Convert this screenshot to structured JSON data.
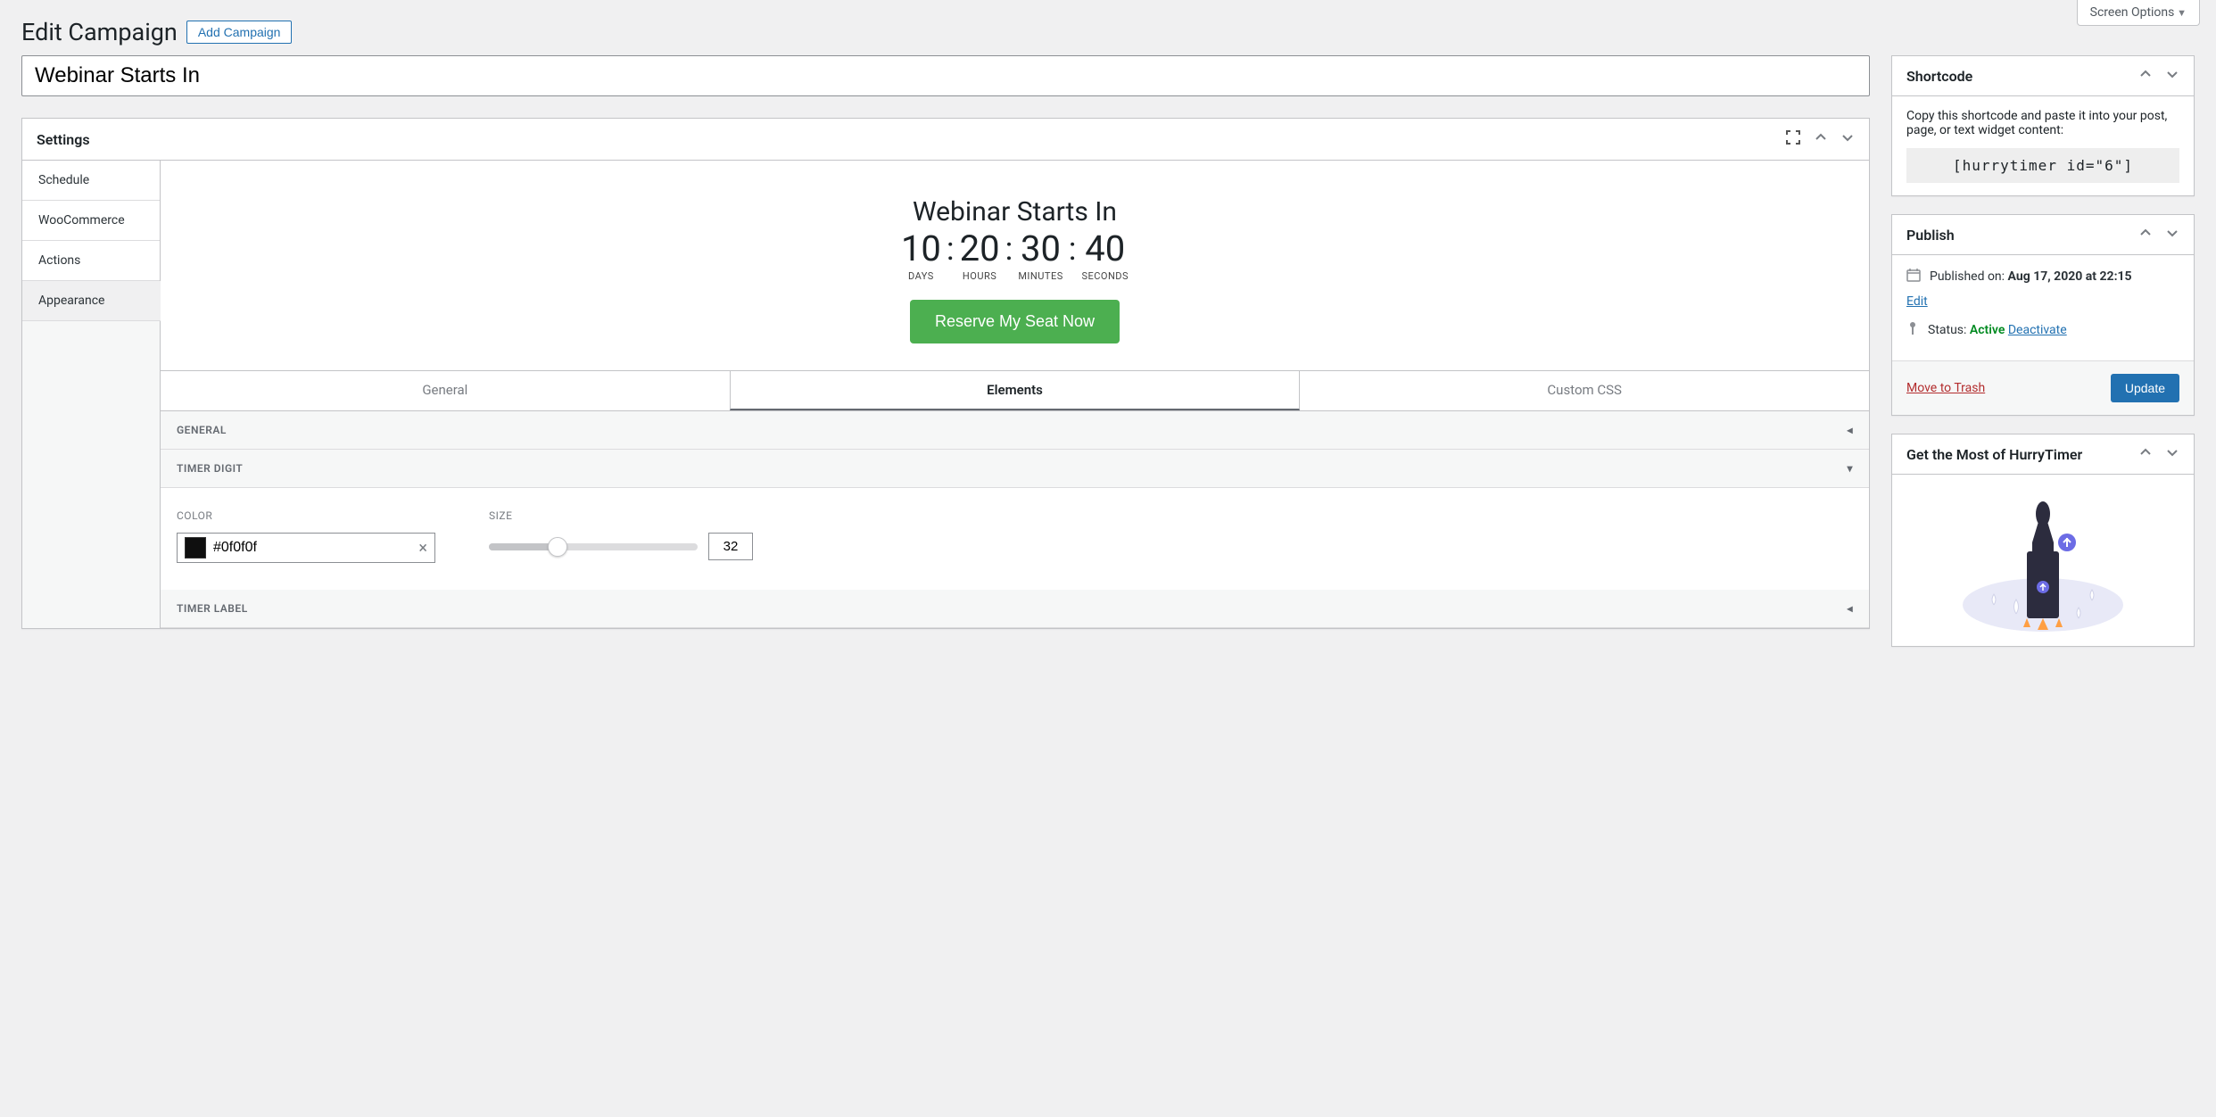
{
  "screenOptions": "Screen Options",
  "pageTitle": "Edit Campaign",
  "addCampaign": "Add Campaign",
  "titleInput": "Webinar Starts In",
  "settingsBox": {
    "title": "Settings",
    "tabs": [
      "Schedule",
      "WooCommerce",
      "Actions",
      "Appearance"
    ],
    "activeTab": "Appearance"
  },
  "preview": {
    "title": "Webinar Starts In",
    "timer": [
      {
        "value": "10",
        "label": "DAYS"
      },
      {
        "value": "20",
        "label": "HOURS"
      },
      {
        "value": "30",
        "label": "MINUTES"
      },
      {
        "value": "40",
        "label": "SECONDS"
      }
    ],
    "button": "Reserve My Seat Now"
  },
  "subTabs": [
    "General",
    "Elements",
    "Custom CSS"
  ],
  "activeSubTab": "Elements",
  "accordions": {
    "general": "GENERAL",
    "timerDigit": "TIMER DIGIT",
    "timerLabel": "TIMER LABEL"
  },
  "timerDigitFields": {
    "colorLabel": "COLOR",
    "colorValue": "#0f0f0f",
    "sizeLabel": "SIZE",
    "sizeValue": "32"
  },
  "shortcodeBox": {
    "title": "Shortcode",
    "desc": "Copy this shortcode and paste it into your post, page, or text widget content:",
    "code": "[hurrytimer id=\"6\"]"
  },
  "publishBox": {
    "title": "Publish",
    "publishedLabel": "Published on:",
    "publishedDate": "Aug 17, 2020 at 22:15",
    "editLink": "Edit",
    "statusLabel": "Status:",
    "statusValue": "Active",
    "deactivateLink": "Deactivate",
    "trashLink": "Move to Trash",
    "updateBtn": "Update"
  },
  "promoBox": {
    "title": "Get the Most of HurryTimer"
  }
}
